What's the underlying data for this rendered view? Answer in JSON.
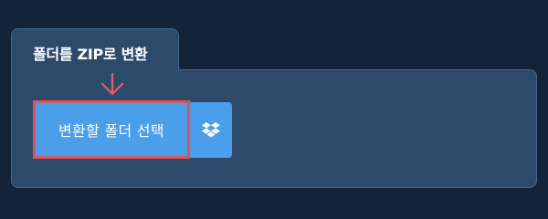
{
  "panel": {
    "title": "폴더를 ZIP로 변환"
  },
  "actions": {
    "select_folder_label": "변환할 폴더 선택",
    "dropbox_icon": "dropbox-icon"
  },
  "colors": {
    "background": "#13243a",
    "panel": "#2e4a6b",
    "button": "#4a9eea",
    "highlight": "#d9555a"
  }
}
